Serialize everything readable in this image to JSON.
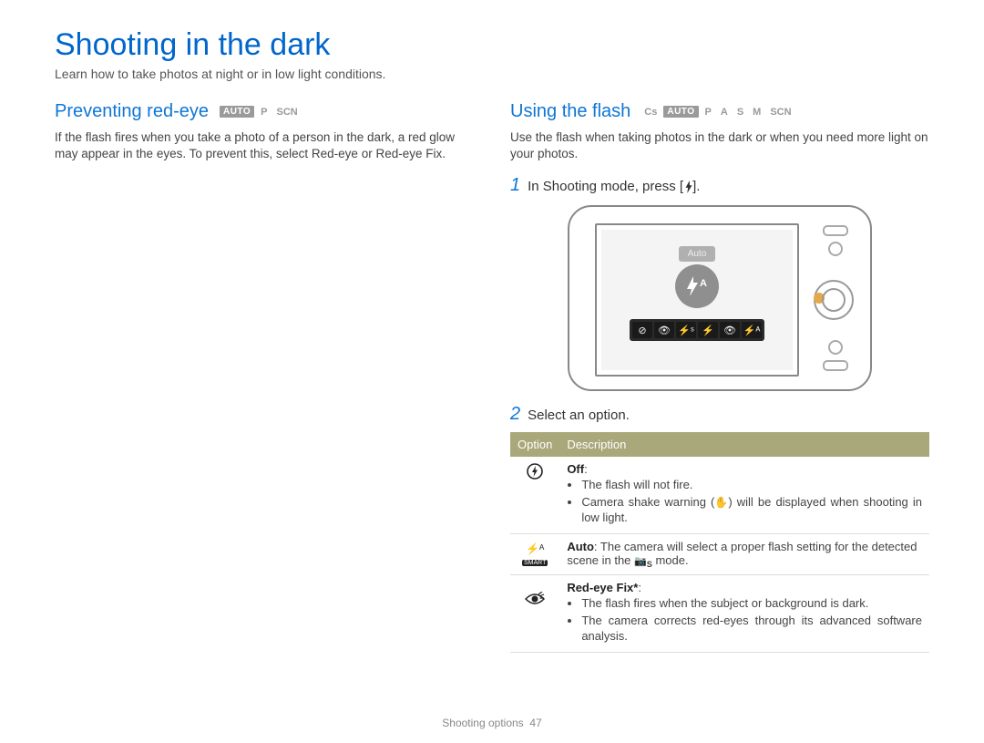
{
  "title": "Shooting in the dark",
  "subtitle": "Learn how to take photos at night or in low light conditions.",
  "left": {
    "heading": "Preventing red-eye",
    "modes": [
      "AUTO",
      "P",
      "SCN"
    ],
    "body_prefix": "If the flash fires when you take a photo of a person in the dark, a red glow may appear in the eyes. To prevent this, select ",
    "body_bold1": "Red-eye",
    "body_mid": " or ",
    "body_bold2": "Red-eye Fix",
    "body_suffix": "."
  },
  "right": {
    "heading": "Using the flash",
    "modes": [
      "Cs",
      "AUTO",
      "P",
      "A",
      "S",
      "M",
      "SCN"
    ],
    "step1_prefix": "In Shooting mode, press [",
    "step1_suffix": "].",
    "step2": "Select an option.",
    "screen_label": "Auto",
    "table": {
      "col1": "Option",
      "col2": "Description",
      "rows": [
        {
          "icon": "flash-off",
          "title": "Off",
          "title_suffix": ":",
          "bullets": [
            "The flash will not fire.",
            "Camera shake warning ( ✋ ) will be displayed when shooting in low light."
          ]
        },
        {
          "icon": "flash-auto-cs",
          "title": "Auto",
          "inline_text": ": The camera will select a proper flash setting for the detected scene in the ",
          "inline_tail": " mode.",
          "cs_text": "Cs"
        },
        {
          "icon": "red-eye-fix",
          "title": "Red-eye Fix*",
          "title_suffix": ":",
          "bullets": [
            "The flash fires when the subject or background is dark.",
            "The camera corrects red-eyes through its advanced software analysis."
          ]
        }
      ]
    }
  },
  "footer": {
    "section": "Shooting options",
    "page": "47"
  }
}
